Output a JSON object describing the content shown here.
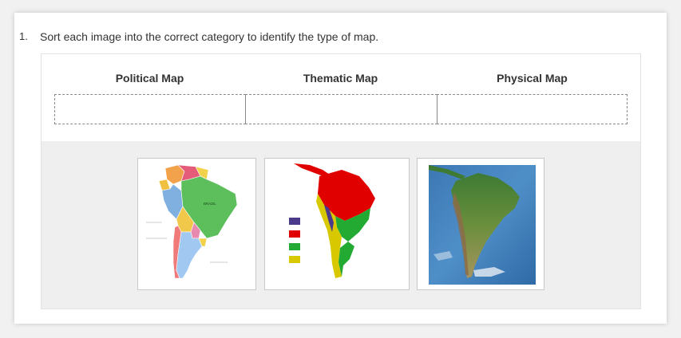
{
  "question": {
    "number": "1.",
    "prompt": "Sort each image into the correct category to identify the type of map."
  },
  "categories": [
    {
      "label": "Political Map"
    },
    {
      "label": "Thematic Map"
    },
    {
      "label": "Physical Map"
    }
  ],
  "images": [
    {
      "name": "political-south-america-map",
      "country_label": "BRAZIL"
    },
    {
      "name": "thematic-south-america-map",
      "legend_colors": [
        "#4b3a8c",
        "#e00000",
        "#22aa33",
        "#d8c800"
      ]
    },
    {
      "name": "physical-south-america-map"
    }
  ],
  "colors": {
    "page_bg": "#f1f1f1",
    "tray_bg": "#efefef",
    "text": "#333333"
  }
}
